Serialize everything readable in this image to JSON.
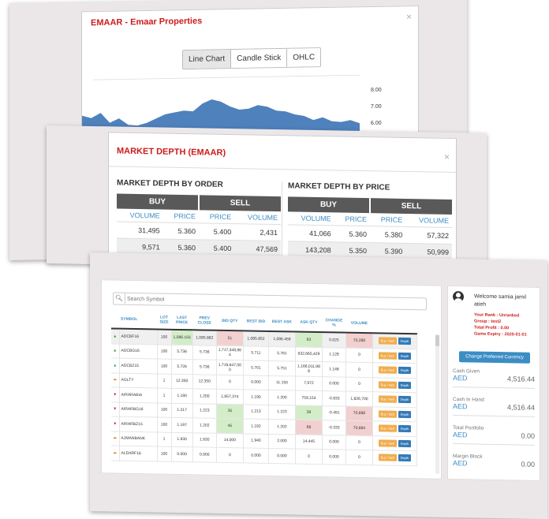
{
  "chart_modal": {
    "title": "EMAAR - Emaar Properties",
    "close": "×",
    "tabs": [
      "Line Chart",
      "Candle Stick",
      "OHLC"
    ],
    "y_ticks": [
      "8.00",
      "7.00",
      "6.00"
    ]
  },
  "chart_data": {
    "type": "area",
    "title": "",
    "xlabel": "",
    "ylabel": "",
    "ylim": [
      5.3,
      8.6
    ],
    "values": [
      6.7,
      6.55,
      6.85,
      6.25,
      6.5,
      6.1,
      6.05,
      6.2,
      6.45,
      6.7,
      6.8,
      6.9,
      6.85,
      7.3,
      7.55,
      7.4,
      7.1,
      6.9,
      6.95,
      7.15,
      7.05,
      6.8,
      6.75,
      6.55,
      6.45,
      6.2,
      6.35,
      6.1,
      6.05,
      6.15,
      5.95
    ]
  },
  "depth_modal": {
    "title": "MARKET DEPTH (EMAAR)",
    "close": "×",
    "by_order": {
      "heading": "MARKET DEPTH BY ORDER",
      "buy": "BUY",
      "sell": "SELL",
      "cols": [
        "VOLUME",
        "PRICE",
        "PRICE",
        "VOLUME"
      ],
      "rows": [
        [
          "31,495",
          "5.360",
          "5.400",
          "2,431"
        ],
        [
          "9,571",
          "5.360",
          "5.400",
          "47,569"
        ]
      ]
    },
    "by_price": {
      "heading": "MARKET DEPTH BY PRICE",
      "buy": "BUY",
      "sell": "SELL",
      "cols": [
        "VOLUME",
        "PRICE",
        "PRICE",
        "VOLUME"
      ],
      "rows": [
        [
          "41,066",
          "5.360",
          "5.380",
          "57,322"
        ],
        [
          "143,208",
          "5.350",
          "5.390",
          "50,999"
        ]
      ]
    }
  },
  "market_watch": {
    "search_icon": "search-icon",
    "search_placeholder": "Search Symbol",
    "headers": [
      "SYMBOL",
      "LOT SIZE",
      "LAST PRICE",
      "PREV CLOSE",
      "BID QTY",
      "BEST BID",
      "BEST ASK",
      "ASK QTY",
      "CHANGE %",
      "VOLUME"
    ],
    "buy_sell_label": "Buy / Sell",
    "depth_label": "Depth",
    "rows": [
      {
        "dir": "up",
        "symbol": "ADCBF16",
        "lot": "100",
        "last": "1,086.155",
        "prev": "1,085.882",
        "bid_qty": "51",
        "best_bid": "1,085.852",
        "best_ask": "1,086.459",
        "ask_qty": "83",
        "change": "0.025",
        "volume": "70,288"
      },
      {
        "dir": "up",
        "symbol": "ADCBG16",
        "lot": "100",
        "last": "5.736",
        "prev": "5.736",
        "bid_qty": "1,717,348,96 4",
        "best_bid": "5.711",
        "best_ask": "5.761",
        "ask_qty": "932,665,429",
        "change": "1.128",
        "volume": "0"
      },
      {
        "dir": "up",
        "symbol": "ADCBZ15",
        "lot": "100",
        "last": "5.726",
        "prev": "5.736",
        "bid_qty": "1,719,647,00 0",
        "best_bid": "5.701",
        "best_ask": "5.751",
        "ask_qty": "1,166,011,98 8",
        "change": "1.148",
        "volume": "0"
      },
      {
        "dir": "flat",
        "symbol": "AGLTY",
        "lot": "1",
        "last": "12.350",
        "prev": "12.350",
        "bid_qty": "0",
        "best_bid": "0.000",
        "best_ask": "11.150",
        "ask_qty": "7,972",
        "change": "0.000",
        "volume": "0"
      },
      {
        "dir": "down",
        "symbol": "AIRARABIA",
        "lot": "1",
        "last": "1.190",
        "prev": "1.200",
        "bid_qty": "1,657,374",
        "best_bid": "1.190",
        "best_ask": "1.200",
        "ask_qty": "759,154",
        "change": "-0.833",
        "volume": "1,826,700"
      },
      {
        "dir": "down",
        "symbol": "AIRARBG16",
        "lot": "100",
        "last": "1.217",
        "prev": "1.223",
        "bid_qty": "35",
        "best_bid": "1.213",
        "best_ask": "1.223",
        "ask_qty": "39",
        "change": "-0.491",
        "volume": "70,688"
      },
      {
        "dir": "down",
        "symbol": "AIRARBZ15",
        "lot": "100",
        "last": "1.197",
        "prev": "1.202",
        "bid_qty": "45",
        "best_bid": "1.192",
        "best_ask": "1.202",
        "ask_qty": "68",
        "change": "-0.333",
        "volume": "70,684"
      },
      {
        "dir": "flat",
        "symbol": "AJMANBANK",
        "lot": "1",
        "last": "1.930",
        "prev": "1.930",
        "bid_qty": "14,000",
        "best_bid": "1.940",
        "best_ask": "2.000",
        "ask_qty": "14,445",
        "change": "0.000",
        "volume": "0"
      },
      {
        "dir": "flat",
        "symbol": "ALDARF16",
        "lot": "100",
        "last": "0.000",
        "prev": "0.000",
        "bid_qty": "0",
        "best_bid": "0.000",
        "best_ask": "0.000",
        "ask_qty": "0",
        "change": "0.000",
        "volume": "0"
      }
    ]
  },
  "sidebar": {
    "welcome": "Welcome samia jamil atieh",
    "rank": "Your Rank : Unranked",
    "group": "Group : test2",
    "profit": "Total Profit : 0.00",
    "expiry": "Game Expiry : 2020-01-01",
    "change_currency": "Change Preferred Currency",
    "stats": [
      {
        "label": "Cash Given",
        "currency": "AED",
        "value": "4,516.44"
      },
      {
        "label": "Cash In Hand",
        "currency": "AED",
        "value": "4,516.44"
      },
      {
        "label": "Total Portfolio",
        "currency": "AED",
        "value": "0.00"
      },
      {
        "label": "Margin Block",
        "currency": "AED",
        "value": "0.00"
      }
    ]
  },
  "colors": {
    "accent": "#3b8dc4",
    "title_red": "#cc1b1b",
    "chart_fill": "#4f81bd",
    "buy_sell": "#f0ad4e",
    "depth": "#337ab7"
  }
}
